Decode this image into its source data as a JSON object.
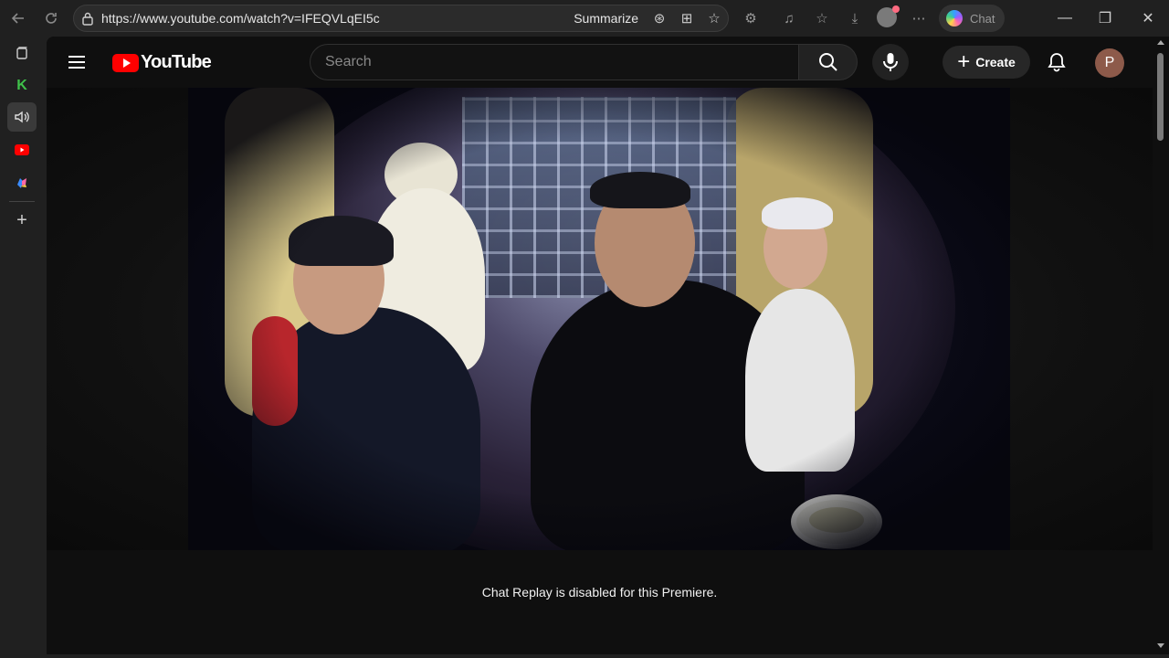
{
  "browser": {
    "url": "https://www.youtube.com/watch?v=IFEQVLqEI5c",
    "summarize_label": "Summarize",
    "chat_label": "Chat",
    "icons": [
      "back-icon",
      "refresh-icon",
      "lock-icon",
      "summarize-icon",
      "split-tab-icon",
      "favorite-star-icon",
      "extensions-icon",
      "read-aloud-icon",
      "favorites-icon",
      "downloads-icon",
      "profile-icon",
      "more-icon",
      "copilot-icon",
      "minimize-icon",
      "restore-icon",
      "close-icon"
    ]
  },
  "sidebar": {
    "items": [
      "tabs-icon",
      "k-app-icon",
      "audio-icon",
      "youtube-icon",
      "copilot-icon",
      "add-icon"
    ]
  },
  "youtube": {
    "logo_text": "YouTube",
    "search_placeholder": "Search",
    "create_label": "Create",
    "avatar_letter": "P",
    "brand_color": "#ff0000"
  },
  "video": {
    "chat_replay_message": "Chat Replay is disabled for this Premiere."
  }
}
